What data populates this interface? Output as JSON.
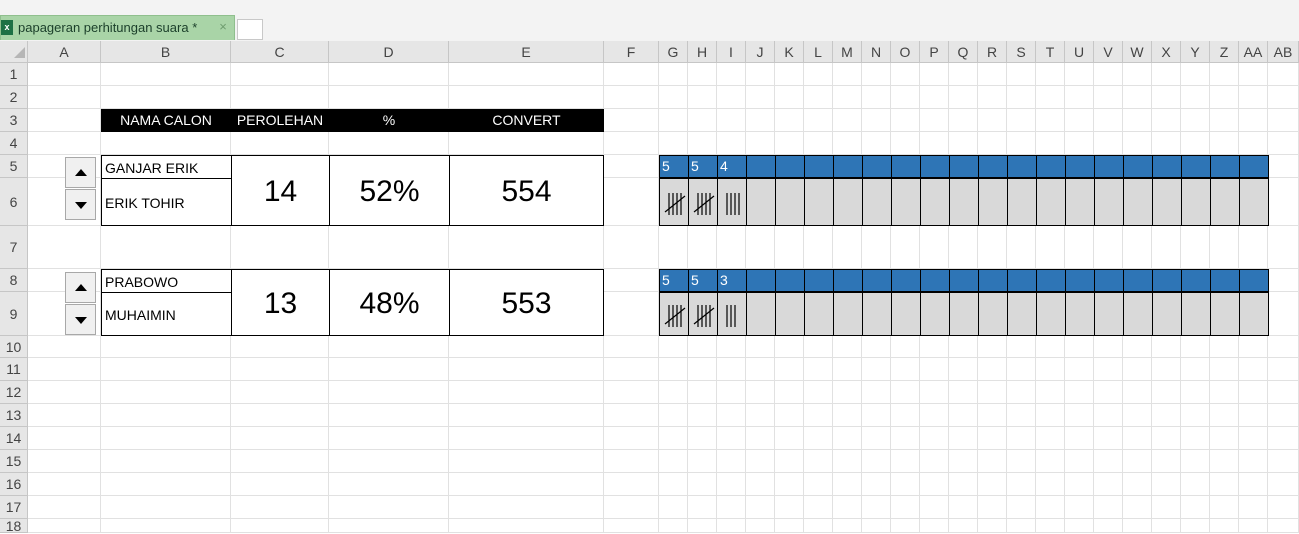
{
  "tab": {
    "icon": "excel-icon",
    "title": "papageran perhitungan suara *",
    "close": "×"
  },
  "columns": [
    "A",
    "B",
    "C",
    "D",
    "E",
    "F",
    "G",
    "H",
    "I",
    "J",
    "K",
    "L",
    "M",
    "N",
    "O",
    "P",
    "Q",
    "R",
    "S",
    "T",
    "U",
    "V",
    "W",
    "X",
    "Y",
    "Z",
    "AA",
    "AB"
  ],
  "rows": [
    "1",
    "2",
    "3",
    "4",
    "5",
    "6",
    "7",
    "8",
    "9",
    "10",
    "11",
    "12",
    "13",
    "14",
    "15",
    "16",
    "17",
    "18"
  ],
  "table_header": {
    "nama": "NAMA CALON",
    "perolehan": "PEROLEHAN",
    "persen": "%",
    "convert": "CONVERT"
  },
  "candidates": [
    {
      "name1": "GANJAR ERIK",
      "name2": "ERIK TOHIR",
      "perolehan": "14",
      "persen": "52%",
      "convert": "554",
      "tally_counts": [
        "5",
        "5",
        "4"
      ],
      "tally_strokes": [
        5,
        5,
        4
      ]
    },
    {
      "name1": "PRABOWO",
      "name2": "MUHAIMIN",
      "perolehan": "13",
      "persen": "48%",
      "convert": "553",
      "tally_counts": [
        "5",
        "5",
        "3"
      ],
      "tally_strokes": [
        5,
        5,
        3
      ]
    }
  ],
  "colors": {
    "header_bg": "#000000",
    "tally_bar": "#2e75b6",
    "tally_cell": "#d9d9d9",
    "tab_active": "#a9d4a7"
  }
}
